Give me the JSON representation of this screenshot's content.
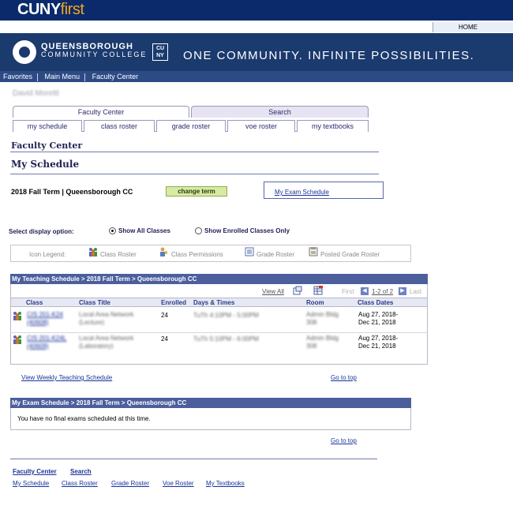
{
  "header": {
    "brand_prefix": "CUNY",
    "brand_suffix": "first",
    "home_label": "HOME",
    "college_line1": "QUEENSBOROUGH",
    "college_line2": "COMMUNITY COLLEGE",
    "cuny_badge": "CU NY",
    "motto": "ONE COMMUNITY. INFINITE POSSIBILITIES."
  },
  "nav": {
    "items": [
      "Favorites",
      "Main Menu",
      "Faculty Center"
    ]
  },
  "user": {
    "name": "David Moretti"
  },
  "tabs": [
    {
      "label": "Faculty Center",
      "active": true
    },
    {
      "label": "Search",
      "active": false
    }
  ],
  "subtabs": [
    "my schedule",
    "class roster",
    "grade roster",
    "voe roster",
    "my textbooks"
  ],
  "page": {
    "section_title": "Faculty Center",
    "title": "My Schedule",
    "term": "2018 Fall Term | Queensborough CC",
    "change_term": "change term",
    "exam_link": "My Exam Schedule"
  },
  "display_option": {
    "label": "Select display option:",
    "options": [
      "Show All Classes",
      "Show Enrolled Classes Only"
    ],
    "selected": "Show All Classes"
  },
  "legend": {
    "label": "Icon Legend:",
    "items": [
      "Class Roster",
      "Class Permissions",
      "Grade Roster",
      "Posted Grade Roster"
    ]
  },
  "teaching": {
    "header": "My Teaching Schedule > 2018 Fall Term > Queensborough CC",
    "view_all": "View All",
    "first": "First",
    "range": "1-2 of 2",
    "last": "Last",
    "columns": [
      "Class",
      "Class Title",
      "Enrolled",
      "Days & Times",
      "Room",
      "Class Dates"
    ],
    "rows": [
      {
        "class_line1": "CIS 201-K24",
        "class_line2": "(40608)",
        "title_line1": "Local Area Network",
        "title_line2": "(Lecture)",
        "enrolled": "24",
        "days": "TuTh 4:10PM - 5:00PM",
        "room_line1": "Admin Bldg",
        "room_line2": "308",
        "dates_line1": "Aug 27, 2018-",
        "dates_line2": "Dec 21, 2018"
      },
      {
        "class_line1": "CIS 201-K24L",
        "class_line2": "(40609)",
        "title_line1": "Local Area Network",
        "title_line2": "(Laboratory)",
        "enrolled": "24",
        "days": "TuTh 5:10PM - 6:00PM",
        "room_line1": "Admin Bldg",
        "room_line2": "308",
        "dates_line1": "Aug 27, 2018-",
        "dates_line2": "Dec 21, 2018"
      }
    ],
    "weekly_link": "View Weekly Teaching Schedule",
    "go_top": "Go to top"
  },
  "exams": {
    "header": "My Exam Schedule > 2018 Fall Term > Queensborough CC",
    "message": "You have no final exams scheduled at this time.",
    "go_top": "Go to top"
  },
  "footer": {
    "row1": [
      "Faculty Center",
      "Search"
    ],
    "row2": [
      "My Schedule",
      "Class Roster",
      "Grade Roster",
      "Voe Roster",
      "My Textbooks"
    ]
  },
  "colors": {
    "banner": "#0a2a6b",
    "brand_accent": "#f2a61f",
    "nav": "#2c4b85",
    "grid_header": "#4c5f9c",
    "button": "#d7eaa1"
  }
}
